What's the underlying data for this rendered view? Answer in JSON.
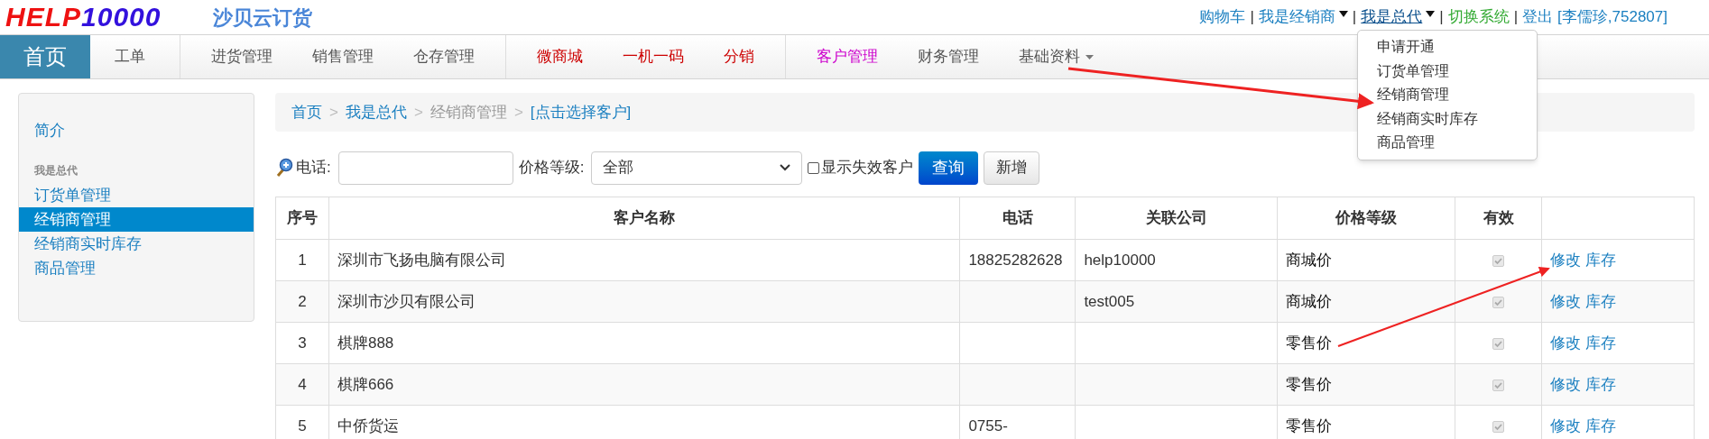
{
  "logo": {
    "part_1": "HELP",
    "part_2": "10000"
  },
  "app_title": "沙贝云订货",
  "top_links": [
    {
      "label": "购物车",
      "kind": "link"
    },
    {
      "label": "|",
      "kind": "separator"
    },
    {
      "label": "我是经销商",
      "kind": "dropdown",
      "expanded": false
    },
    {
      "label": "|",
      "kind": "separator"
    },
    {
      "label": "我是总代",
      "kind": "dropdown",
      "expanded": true
    },
    {
      "label": "|",
      "kind": "separator"
    },
    {
      "label": "切换系统",
      "kind": "switch"
    },
    {
      "label": "|",
      "kind": "separator"
    },
    {
      "label": "登出",
      "kind": "link"
    },
    {
      "label": "[李儒珍,752807]",
      "kind": "user"
    }
  ],
  "dropdown_menu": [
    "申请开通",
    "订货单管理",
    "经销商管理",
    "经销商实时库存",
    "商品管理"
  ],
  "nav": [
    {
      "label": "首页",
      "selected": true,
      "divider_before": false,
      "color": "#ffffff"
    },
    {
      "label": "工单",
      "selected": false,
      "divider_before": false,
      "color": "#555555"
    },
    {
      "label": "进货管理",
      "selected": false,
      "divider_before": true,
      "color": "#555555"
    },
    {
      "label": "销售管理",
      "selected": false,
      "divider_before": false,
      "color": "#555555"
    },
    {
      "label": "仓存管理",
      "selected": false,
      "divider_before": false,
      "color": "#555555"
    },
    {
      "label": "微商城",
      "selected": false,
      "divider_before": true,
      "color": "#cc0000"
    },
    {
      "label": "一机一码",
      "selected": false,
      "divider_before": false,
      "color": "#cc0000"
    },
    {
      "label": "分销",
      "selected": false,
      "divider_before": false,
      "color": "#cc0000"
    },
    {
      "label": "客户管理",
      "selected": false,
      "divider_before": true,
      "color": "#cc00cc"
    },
    {
      "label": "财务管理",
      "selected": false,
      "divider_before": false,
      "color": "#555555"
    },
    {
      "label": "基础资料",
      "selected": false,
      "divider_before": false,
      "color": "#555555",
      "has_menu": true
    }
  ],
  "sidebar": {
    "top_link": "简介",
    "section": "我是总代",
    "items": [
      {
        "label": "订货单管理",
        "selected": false
      },
      {
        "label": "经销商管理",
        "selected": true
      },
      {
        "label": "经销商实时库存",
        "selected": false
      },
      {
        "label": "商品管理",
        "selected": false
      }
    ]
  },
  "breadcrumb": [
    {
      "label": "首页",
      "kind": "link"
    },
    {
      "label": ">",
      "kind": "separator"
    },
    {
      "label": "我是总代",
      "kind": "link"
    },
    {
      "label": ">",
      "kind": "separator"
    },
    {
      "label": "经销商管理",
      "kind": "current"
    },
    {
      "label": ">",
      "kind": "separator"
    },
    {
      "label": "[点击选择客户]",
      "kind": "link"
    }
  ],
  "search": {
    "phone_label": "电话:",
    "price_label": "价格等级:",
    "price_value": "全部",
    "show_inactive_label": "显示失效客户",
    "show_inactive": false,
    "query_button": "查询",
    "add_button": "新增"
  },
  "table": {
    "columns": [
      "序号",
      "客户名称",
      "电话",
      "关联公司",
      "价格等级",
      "有效"
    ],
    "rows": [
      {
        "index": "1",
        "name": "深圳市飞扬电脑有限公司",
        "phone": "18825282628",
        "company": "help10000",
        "price": "商城价",
        "valid": true,
        "actions": [
          "修改",
          "库存"
        ]
      },
      {
        "index": "2",
        "name": "深圳市沙贝有限公司",
        "phone": "",
        "company": "test005",
        "price": "商城价",
        "valid": true,
        "actions": [
          "修改",
          "库存"
        ]
      },
      {
        "index": "3",
        "name": "棋牌888",
        "phone": "",
        "company": "",
        "price": "零售价",
        "valid": true,
        "actions": [
          "修改",
          "库存"
        ]
      },
      {
        "index": "4",
        "name": "棋牌666",
        "phone": "",
        "company": "",
        "price": "零售价",
        "valid": true,
        "actions": [
          "修改",
          "库存"
        ]
      },
      {
        "index": "5",
        "name": "中侨货运",
        "phone": "0755-",
        "company": "",
        "price": "零售价",
        "valid": true,
        "actions": [
          "修改",
          "库存"
        ]
      }
    ]
  }
}
